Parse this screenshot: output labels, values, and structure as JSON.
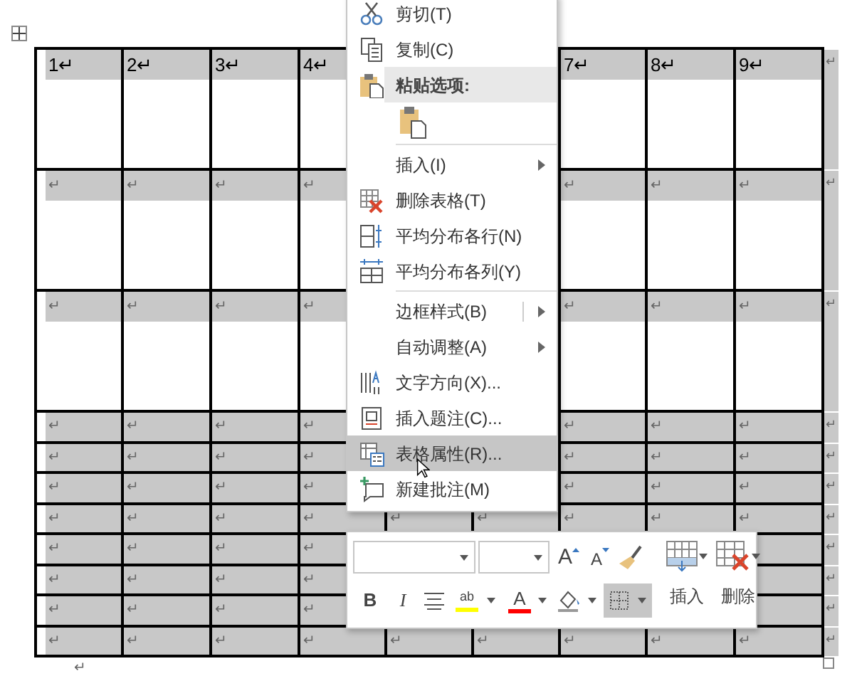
{
  "table": {
    "selected": true,
    "rows": [
      {
        "kind": "tall",
        "cells": [
          "1↵",
          "2↵",
          "3↵",
          "4↵",
          false,
          null,
          "7↵",
          "8↵",
          "9↵"
        ],
        "row_end": "↵"
      },
      {
        "kind": "tall",
        "cells": [
          "↵",
          "↵",
          "↵",
          "↵",
          false,
          null,
          "↵",
          "↵",
          "↵"
        ],
        "row_end": "↵"
      },
      {
        "kind": "tall",
        "cells": [
          "↵",
          "↵",
          "↵",
          "↵",
          false,
          null,
          "↵",
          "↵",
          "↵"
        ],
        "row_end": "↵"
      },
      {
        "kind": "short",
        "cells": [
          "↵",
          "↵",
          "↵",
          "↵",
          false,
          null,
          "↵",
          "↵",
          "↵"
        ],
        "row_end": "↵"
      },
      {
        "kind": "short",
        "cells": [
          "↵",
          "↵",
          "↵",
          "↵",
          null,
          null,
          "↵",
          "↵",
          "↵"
        ],
        "row_end": "↵"
      },
      {
        "kind": "short",
        "cells": [
          "↵",
          "↵",
          "↵",
          "↵",
          null,
          null,
          "↵",
          "↵",
          "↵"
        ],
        "row_end": "↵"
      },
      {
        "kind": "short",
        "cells": [
          "↵",
          "↵",
          "↵",
          "↵",
          "↵",
          "↵",
          "↵",
          "↵",
          "↵"
        ],
        "row_end": "↵"
      },
      {
        "kind": "short",
        "cells": [
          "↵",
          "↵",
          "↵",
          "↵",
          null,
          null,
          null,
          null,
          null
        ],
        "row_end": "↵"
      },
      {
        "kind": "short",
        "cells": [
          "↵",
          "↵",
          "↵",
          "↵",
          null,
          null,
          null,
          null,
          null
        ],
        "row_end": "↵"
      },
      {
        "kind": "short",
        "cells": [
          "↵",
          "↵",
          "↵",
          "↵",
          null,
          null,
          null,
          null,
          null
        ],
        "row_end": "↵"
      },
      {
        "kind": "short",
        "cells": [
          "↵",
          "↵",
          "↵",
          "↵",
          "↵",
          "↵",
          "↵",
          "↵",
          "↵"
        ],
        "row_end": "↵"
      }
    ]
  },
  "after_table": "↵",
  "context_menu": {
    "groups": [
      [
        {
          "kind": "command",
          "label": "剪切(T)",
          "submenu": false,
          "split": false,
          "selected": false
        },
        {
          "kind": "command",
          "label": "复制(C)",
          "submenu": false,
          "split": false,
          "selected": false
        },
        {
          "kind": "heading",
          "label": "粘贴选项:",
          "selected": false
        },
        {
          "kind": "paste-option",
          "selected": false
        }
      ],
      [
        {
          "kind": "command",
          "label": "插入(I)",
          "submenu": true,
          "split": false,
          "selected": false
        },
        {
          "kind": "command",
          "label": "删除表格(T)",
          "submenu": false,
          "split": false,
          "selected": false
        },
        {
          "kind": "command",
          "label": "平均分布各行(N)",
          "submenu": false,
          "split": false,
          "selected": false
        },
        {
          "kind": "command",
          "label": "平均分布各列(Y)",
          "submenu": false,
          "split": false,
          "selected": false
        }
      ],
      [
        {
          "kind": "command",
          "label": "边框样式(B)",
          "submenu": true,
          "split": true,
          "selected": false
        },
        {
          "kind": "command",
          "label": "自动调整(A)",
          "submenu": true,
          "split": false,
          "selected": false
        },
        {
          "kind": "command",
          "label": "文字方向(X)...",
          "submenu": false,
          "split": false,
          "selected": false
        },
        {
          "kind": "command",
          "label": "插入题注(C)...",
          "submenu": false,
          "split": false,
          "selected": false
        },
        {
          "kind": "command",
          "label": "表格属性(R)...",
          "submenu": false,
          "split": false,
          "selected": true
        },
        {
          "kind": "command",
          "label": "新建批注(M)",
          "submenu": false,
          "split": false,
          "selected": false
        }
      ]
    ]
  },
  "mini_toolbar": {
    "grow_font": "A",
    "shrink_font": "A",
    "bold": "B",
    "italic": "I",
    "highlight": {
      "glyph": "ab",
      "color": "#ffff00"
    },
    "font_color": {
      "glyph": "A",
      "color": "#ff0000"
    },
    "borders": {
      "selected": true
    },
    "insert": "插入",
    "delete": "删除"
  }
}
